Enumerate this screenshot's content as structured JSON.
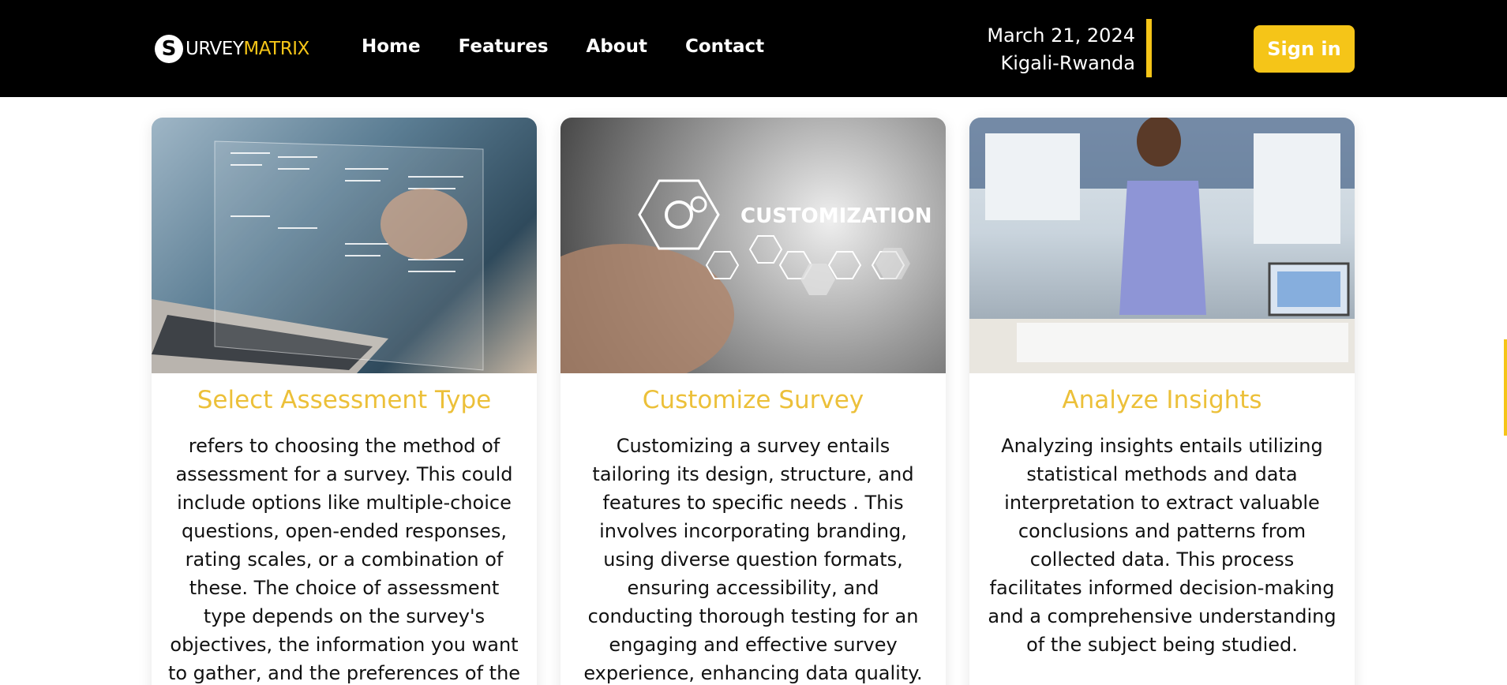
{
  "brand": {
    "badge": "S",
    "name_part1": "URVEY",
    "name_part2": "MATRIX"
  },
  "nav": [
    {
      "label": "Home"
    },
    {
      "label": "Features"
    },
    {
      "label": "About"
    },
    {
      "label": "Contact"
    }
  ],
  "header": {
    "date": "March 21, 2024",
    "location": "Kigali-Rwanda",
    "signin_label": "Sign in"
  },
  "colors": {
    "accent": "#f5c518",
    "title": "#ecc039",
    "nav_bg": "#000000"
  },
  "cards": [
    {
      "image_label": "",
      "title": "Select Assessment Type",
      "body": "refers to choosing the method of assessment for a survey. This could include options like multiple-choice questions, open-ended responses, rating scales, or a combination of these. The choice of assessment type depends on the survey's objectives, the information you want to gather, and the preferences of the"
    },
    {
      "image_label": "CUSTOMIZATION",
      "title": "Customize Survey",
      "body": "Customizing a survey entails tailoring its design, structure, and features to specific needs . This involves incorporating branding, using diverse question formats, ensuring accessibility, and conducting thorough testing for an engaging and effective survey experience, enhancing data quality."
    },
    {
      "image_label": "",
      "title": "Analyze Insights",
      "body": "Analyzing insights entails utilizing statistical methods and data interpretation to extract valuable conclusions and patterns from collected data. This process facilitates informed decision-making and a comprehensive understanding of the subject being studied."
    }
  ]
}
